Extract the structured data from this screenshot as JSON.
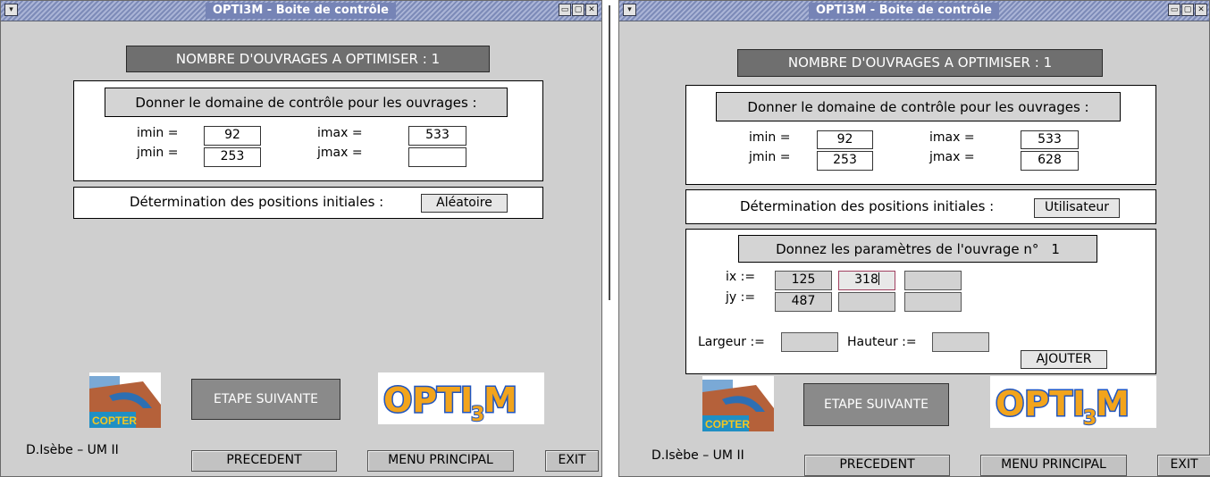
{
  "app": {
    "title": "OPTI3M - Boite de contrôle",
    "menu_symbol": "▾",
    "win_buttons": [
      "▭",
      "▢",
      "✕"
    ],
    "count_label": "NOMBRE D'OUVRAGES A OPTIMISER :",
    "count_value": "1"
  },
  "domain": {
    "heading": "Donner le domaine de contrôle pour les ouvrages :",
    "imin_label": "imin =",
    "jmin_label": "jmin =",
    "imax_label": "imax =",
    "jmax_label": "jmax ="
  },
  "init_label": "Détermination des positions initiales :",
  "left": {
    "imin": "92",
    "jmin": "253",
    "imax": "533",
    "jmax": "",
    "init_button": "Aléatoire"
  },
  "right": {
    "imin": "92",
    "jmin": "253",
    "imax": "533",
    "jmax": "628",
    "init_button": "Utilisateur",
    "params": {
      "heading": "Donnez les paramètres de l'ouvrage n°",
      "number": "1",
      "ix_label": "ix :=",
      "jy_label": "jy :=",
      "ix": [
        "125",
        "318",
        ""
      ],
      "jy": [
        "487",
        "",
        ""
      ],
      "largeur_label": "Largeur :=",
      "hauteur_label": "Hauteur :=",
      "largeur": "",
      "hauteur": "",
      "add_button": "AJOUTER"
    }
  },
  "logos": {
    "copter": "COPTER"
  },
  "footer": {
    "etape_button": "ETAPE SUIVANTE",
    "author": "D.Isèbe – UM II",
    "prev_button": "PRECEDENT",
    "menu_button": "MENU PRINCIPAL",
    "exit_button": "EXIT"
  },
  "colors": {
    "window_bg": "#cfcfcf",
    "titlebar": "#7d8bb8",
    "dark_banner": "#6f6f6f",
    "logo_orange": "#f08a1c"
  }
}
